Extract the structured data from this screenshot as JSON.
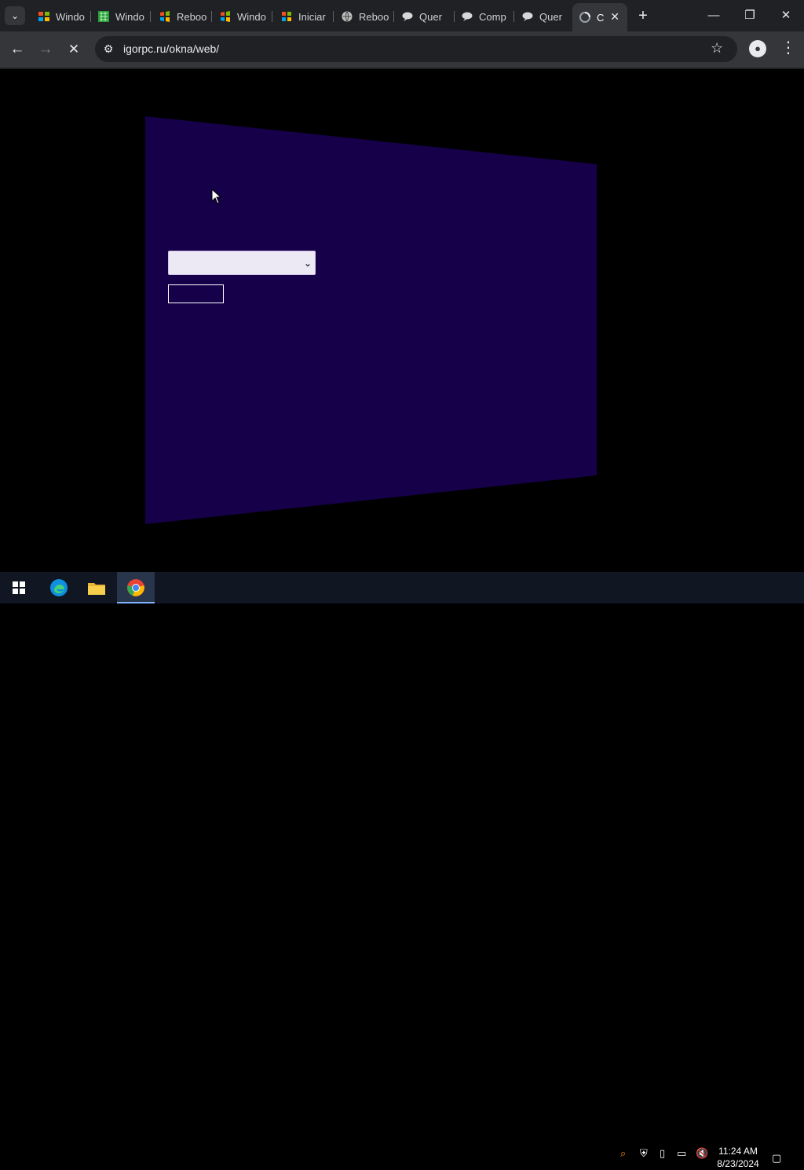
{
  "browser": {
    "tabs": [
      {
        "label": "Windo",
        "icon": "windows-colorful-icon"
      },
      {
        "label": "Windo",
        "icon": "green-grid-icon"
      },
      {
        "label": "Reboo",
        "icon": "windows-xp-icon"
      },
      {
        "label": "Windo",
        "icon": "windows-xp-icon"
      },
      {
        "label": "Iniciar",
        "icon": "windows-start-icon"
      },
      {
        "label": "Reboo",
        "icon": "globe-icon"
      },
      {
        "label": "Quer",
        "icon": "chat-icon"
      },
      {
        "label": "Comp",
        "icon": "chat-icon"
      },
      {
        "label": "Quer",
        "icon": "chat-icon"
      },
      {
        "label": "C",
        "icon": "loading-icon",
        "active": true
      }
    ],
    "address": "igorpc.ru/okna/web/",
    "nav": {
      "back": "←",
      "forward": "→",
      "stop": "✕"
    }
  },
  "page": {
    "background": "#000000",
    "panel_color": "#16004a",
    "dropdown_value": "",
    "button_label": ""
  },
  "taskbar": {
    "time": "11:24 AM",
    "date": "8/23/2024"
  }
}
